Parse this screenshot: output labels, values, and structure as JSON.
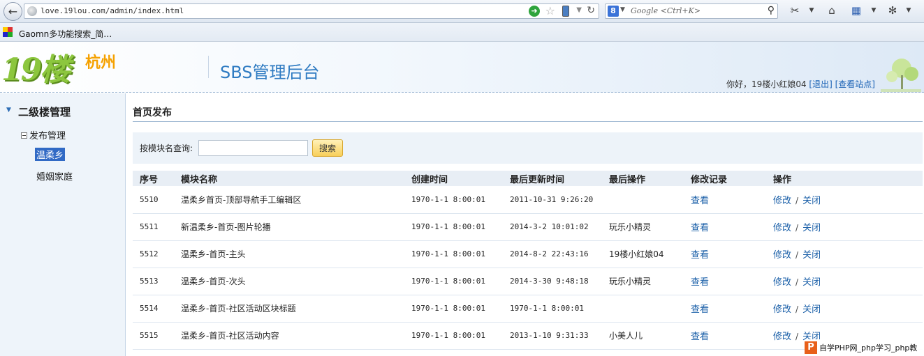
{
  "browser": {
    "url": "love.19lou.com/admin/index.html",
    "search_placeholder": "Google <Ctrl+K>",
    "search_engine_letter": "8",
    "bookmark_label": "Gaomn多功能搜索_简…"
  },
  "header": {
    "logo_number": "19楼",
    "logo_city": "杭州",
    "title": "SBS管理后台",
    "greeting": "你好，19楼小红娘04",
    "logout": "[退出]",
    "view_site": "[查看站点]"
  },
  "sidebar": {
    "section": "二级楼管理",
    "group": "发布管理",
    "items": [
      {
        "label": "温柔乡",
        "active": true
      },
      {
        "label": "婚姻家庭",
        "active": false
      }
    ]
  },
  "main": {
    "title": "首页发布",
    "filter_label": "按模块名查询:",
    "filter_value": "",
    "search_button": "搜索",
    "columns": [
      "序号",
      "模块名称",
      "创建时间",
      "最后更新时间",
      "最后操作",
      "修改记录",
      "操作"
    ],
    "rows": [
      {
        "id": "5510",
        "name": "温柔乡首页-顶部导航手工编辑区",
        "created": "1970-1-1 8:00:01",
        "updated": "2011-10-31 9:26:20",
        "operator": "",
        "log": "查看",
        "edit": "修改",
        "close": "关闭"
      },
      {
        "id": "5511",
        "name": "新温柔乡-首页-图片轮播",
        "created": "1970-1-1 8:00:01",
        "updated": "2014-3-2 10:01:02",
        "operator": "玩乐小精灵",
        "log": "查看",
        "edit": "修改",
        "close": "关闭"
      },
      {
        "id": "5512",
        "name": "温柔乡-首页-主头",
        "created": "1970-1-1 8:00:01",
        "updated": "2014-8-2 22:43:16",
        "operator": "19楼小红娘04",
        "log": "查看",
        "edit": "修改",
        "close": "关闭"
      },
      {
        "id": "5513",
        "name": "温柔乡-首页-次头",
        "created": "1970-1-1 8:00:01",
        "updated": "2014-3-30 9:48:18",
        "operator": "玩乐小精灵",
        "log": "查看",
        "edit": "修改",
        "close": "关闭"
      },
      {
        "id": "5514",
        "name": "温柔乡-首页-社区活动区块标题",
        "created": "1970-1-1 8:00:01",
        "updated": "1970-1-1 8:00:01",
        "operator": "",
        "log": "查看",
        "edit": "修改",
        "close": "关闭"
      },
      {
        "id": "5515",
        "name": "温柔乡-首页-社区活动内容",
        "created": "1970-1-1 8:00:01",
        "updated": "2013-1-10 9:31:33",
        "operator": "小美人儿",
        "log": "查看",
        "edit": "修改",
        "close": "关闭"
      }
    ]
  },
  "watermark": {
    "icon_letter": "P",
    "text": "自学PHP网_php学习_php教"
  }
}
